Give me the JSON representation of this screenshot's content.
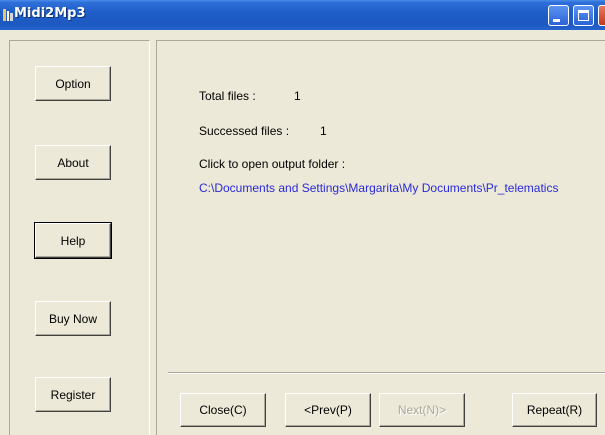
{
  "window": {
    "title": "Midi2Mp3",
    "title_icon": "app-icon",
    "controls": [
      "minimize-icon",
      "maximize-icon",
      "close-icon"
    ]
  },
  "sidebar": {
    "buttons": [
      {
        "label": "Option"
      },
      {
        "label": "About"
      },
      {
        "label": "Help"
      },
      {
        "label": "Buy Now"
      },
      {
        "label": "Register"
      }
    ]
  },
  "results": {
    "total_files_label": "Total files :",
    "total_files_value": "1",
    "succeeded_files_label": "Successed files :",
    "succeeded_files_value": "1",
    "open_folder_label": "Click to open output folder :",
    "output_path": "C:\\Documents and Settings\\Margarita\\My Documents\\Pr_telematics"
  },
  "footer": {
    "close_label": "Close(C)",
    "prev_label": "<Prev(P)",
    "next_label": "Next(N)>",
    "repeat_label": "Repeat(R)"
  },
  "colors": {
    "link": "#2a2ad8",
    "titlebar": "#1f5ec8",
    "face": "#ece9d8"
  }
}
